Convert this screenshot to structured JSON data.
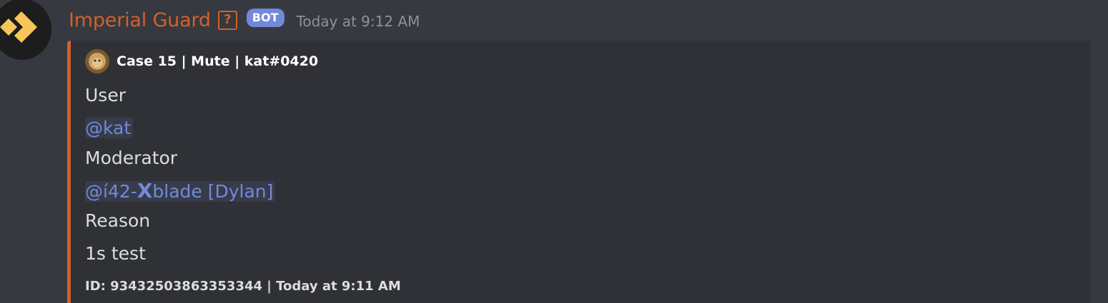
{
  "message": {
    "username": "Imperial Guard",
    "help_icon_text": "?",
    "bot_badge": "BOT",
    "timestamp": "Today at 9:12 AM",
    "colors": {
      "username": "#d3602a",
      "embed_border": "#d3602a",
      "bot_badge": "#7289da",
      "mention": "#7289da",
      "background": "#36393f",
      "embed_background": "#2f3136"
    },
    "avatar_icon": "imperial-guard-logo-icon"
  },
  "embed": {
    "author": "Case 15 | Mute | kat#0420",
    "author_icon": "lion-avatar-icon",
    "user_label": "User",
    "user_mention": "@kat",
    "moderator_label": "Moderator",
    "moderator_mention_prefix": "@í42-",
    "moderator_mention_x": "X",
    "moderator_mention_suffix": "blade [Dylan]",
    "reason_label": "Reason",
    "reason_value": "1s test",
    "footer": "ID: 93432503863353344 | Today at 9:11 AM"
  }
}
